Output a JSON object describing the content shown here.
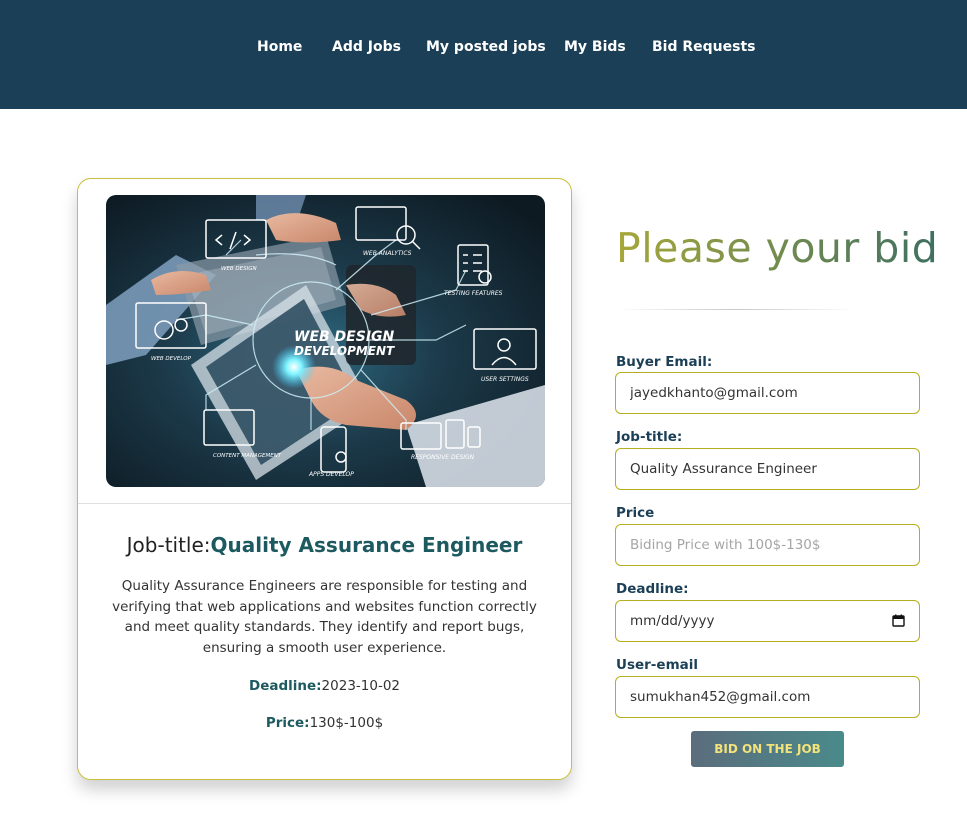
{
  "nav": {
    "items": [
      {
        "label": "Home"
      },
      {
        "label": "Add Jobs"
      },
      {
        "label": "My posted jobs"
      },
      {
        "label": "My Bids"
      },
      {
        "label": "Bid Requests"
      }
    ]
  },
  "job": {
    "image_text": {
      "main_line1": "WEB DESIGN",
      "main_line2": "DEVELOPMENT",
      "labels": [
        "WEB ANALYTICS",
        "TESTING FEATURES",
        "USER SETTINGS",
        "RESPONSIVE DESIGN",
        "APPS DEVELOP",
        "CONTENT MANAGEMENT",
        "WEB DEVELOP",
        "WEB DESIGN"
      ]
    },
    "title_prefix": "Job-title:",
    "title": "Quality Assurance Engineer",
    "description": "Quality Assurance Engineers are responsible for testing and verifying that web applications and websites function correctly and meet quality standards. They identify and report bugs, ensuring a smooth user experience.",
    "deadline_label": "Deadline:",
    "deadline": "2023-10-02",
    "price_label": "Price:",
    "price": "130$-100$"
  },
  "form": {
    "heading": "Please your bid",
    "buyer_email_label": "Buyer Email:",
    "buyer_email": "jayedkhanto@gmail.com",
    "job_title_label": "Job-title:",
    "job_title": "Quality Assurance Engineer",
    "price_label": "Price",
    "price_placeholder": "Biding Price with 100$-130$",
    "deadline_label": "Deadline:",
    "deadline_placeholder": "mm/dd/yyyy",
    "user_email_label": "User-email",
    "user_email": "sumukhan452@gmail.com",
    "submit_label": "BID ON THE JOB"
  },
  "colors": {
    "navbar": "#1b3f56",
    "accent_border": "#b5ae22",
    "title_teal": "#1d5a60",
    "button_text": "#f3e37a"
  }
}
